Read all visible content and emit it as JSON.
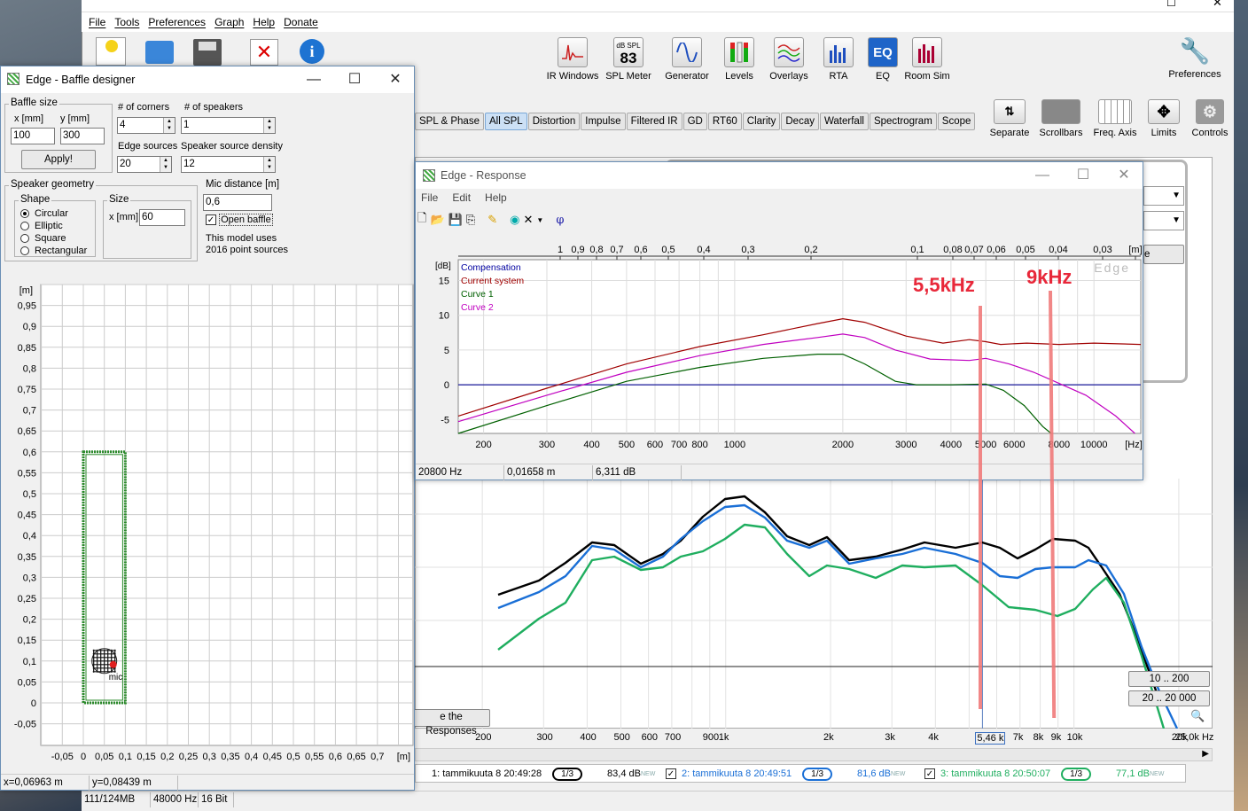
{
  "app": {
    "menu": [
      "File",
      "Tools",
      "Preferences",
      "Graph",
      "Help",
      "Donate"
    ],
    "toolbar": [
      {
        "label": "IR Windows",
        "icon": "ir-windows-icon"
      },
      {
        "label": "SPL Meter",
        "icon": "spl-meter-icon",
        "display_top": "dB SPL",
        "display_value": "83"
      },
      {
        "label": "Generator",
        "icon": "generator-icon"
      },
      {
        "label": "Levels",
        "icon": "levels-icon"
      },
      {
        "label": "Overlays",
        "icon": "overlays-icon"
      },
      {
        "label": "RTA",
        "icon": "rta-icon"
      },
      {
        "label": "EQ",
        "icon": "eq-icon",
        "glyph": "EQ"
      },
      {
        "label": "Room Sim",
        "icon": "room-sim-icon"
      }
    ],
    "preferences_label": "Preferences",
    "tabs": [
      "SPL & Phase",
      "All SPL",
      "Distortion",
      "Impulse",
      "Filtered IR",
      "GD",
      "RT60",
      "Clarity",
      "Decay",
      "Waterfall",
      "Spectrogram",
      "Scope"
    ],
    "active_tab": "All SPL",
    "view_controls": [
      "Separate",
      "Scrollbars",
      "Freq. Axis",
      "Limits",
      "Controls"
    ],
    "buttons": {
      "range1": "10 .. 200",
      "range2": "20 .. 20 000",
      "responses": "e the Responses",
      "partial": "e"
    },
    "x_axis_labels": [
      "200",
      "300",
      "400",
      "500",
      "600",
      "700",
      "900",
      "1k",
      "2k",
      "3k",
      "4k",
      "5,46 k",
      "7k",
      "8k",
      "9k",
      "10k",
      "20k",
      "25,0k Hz"
    ],
    "measurements": [
      {
        "checked": "✓",
        "name": "1: tammikuuta 8 20:49:28",
        "smoothing": "1/3",
        "level": "83,4 dB",
        "badge": "NEW",
        "color": "#000000"
      },
      {
        "checked": "✓",
        "name": "2: tammikuuta 8 20:49:51",
        "smoothing": "1/3",
        "level": "81,6 dB",
        "badge": "NEW",
        "color": "#1a6fd6"
      },
      {
        "checked": "✓",
        "name": "3: tammikuuta 8 20:50:07",
        "smoothing": "1/3",
        "level": "77,1 dB",
        "badge": "NEW",
        "color": "#1fae5f"
      }
    ],
    "status": {
      "memory": "111/124MB",
      "rate": "48000 Hz",
      "bits": "16 Bit"
    }
  },
  "baffle": {
    "title": "Edge - Baffle designer",
    "baffle_size": "Baffle size",
    "x_label": "x [mm]",
    "y_label": "y [mm]",
    "x_value": "100",
    "y_value": "300",
    "apply": "Apply!",
    "corners_label": "# of corners",
    "corners_value": "4",
    "speakers_label": "# of speakers",
    "speakers_value": "1",
    "edge_label": "Edge sources",
    "edge_value": "20",
    "density_label": "Speaker source density",
    "density_value": "12",
    "geometry_label": "Speaker geometry",
    "shape_label": "Shape",
    "shapes": [
      "Circular",
      "Elliptic",
      "Square",
      "Rectangular"
    ],
    "size_label": "Size",
    "size_x_label": "x [mm]",
    "size_value": "60",
    "mic_label": "Mic distance [m]",
    "mic_value": "0,6",
    "open_baffle": "Open baffle",
    "open_checked": "✓",
    "model_line1": "This model uses",
    "model_line2": "2016 point sources",
    "axis_unit": "[m]",
    "y_ticks": [
      "0,95",
      "0,9",
      "0,85",
      "0,8",
      "0,75",
      "0,7",
      "0,65",
      "0,6",
      "0,55",
      "0,5",
      "0,45",
      "0,4",
      "0,35",
      "0,3",
      "0,25",
      "0,2",
      "0,15",
      "0,1",
      "0,05",
      "0",
      "-0,05"
    ],
    "x_ticks": [
      "-0,05",
      "0",
      "0,05",
      "0,1",
      "0,15",
      "0,2",
      "0,25",
      "0,3",
      "0,35",
      "0,4",
      "0,45",
      "0,5",
      "0,55",
      "0,6",
      "0,65",
      "0,7"
    ],
    "mic_text": "mic",
    "status_x": "x=0,06963 m",
    "status_y": "y=0,08439 m"
  },
  "response": {
    "title": "Edge - Response",
    "menu": [
      "File",
      "Edit",
      "Help"
    ],
    "legend": [
      {
        "name": "Compensation",
        "color": "#0000a0"
      },
      {
        "name": "Current system",
        "color": "#a00000"
      },
      {
        "name": "Curve 1",
        "color": "#006000"
      },
      {
        "name": "Curve 2",
        "color": "#c000c0"
      }
    ],
    "watermark": "Edge",
    "top_axis": [
      "1",
      "0,9",
      "0,8",
      "0,7",
      "0,6",
      "0,5",
      "0,4",
      "0,3",
      "0,2",
      "0,1",
      "0,08",
      "0,07",
      "0,06",
      "0,05",
      "0,04",
      "0,03",
      "[m]"
    ],
    "y_unit": "[dB]",
    "y_ticks": [
      "15",
      "10",
      "5",
      "0",
      "-5"
    ],
    "x_ticks": [
      "200",
      "300",
      "400",
      "500",
      "600",
      "700",
      "800",
      "1000",
      "2000",
      "3000",
      "4000",
      "5000",
      "6000",
      "8000",
      "10000",
      "[Hz]"
    ],
    "status": {
      "freq": "20800 Hz",
      "dist": "0,01658 m",
      "level": "6,311 dB"
    },
    "annotation_5k": "5,5kHz",
    "annotation_9k": "9kHz"
  }
}
